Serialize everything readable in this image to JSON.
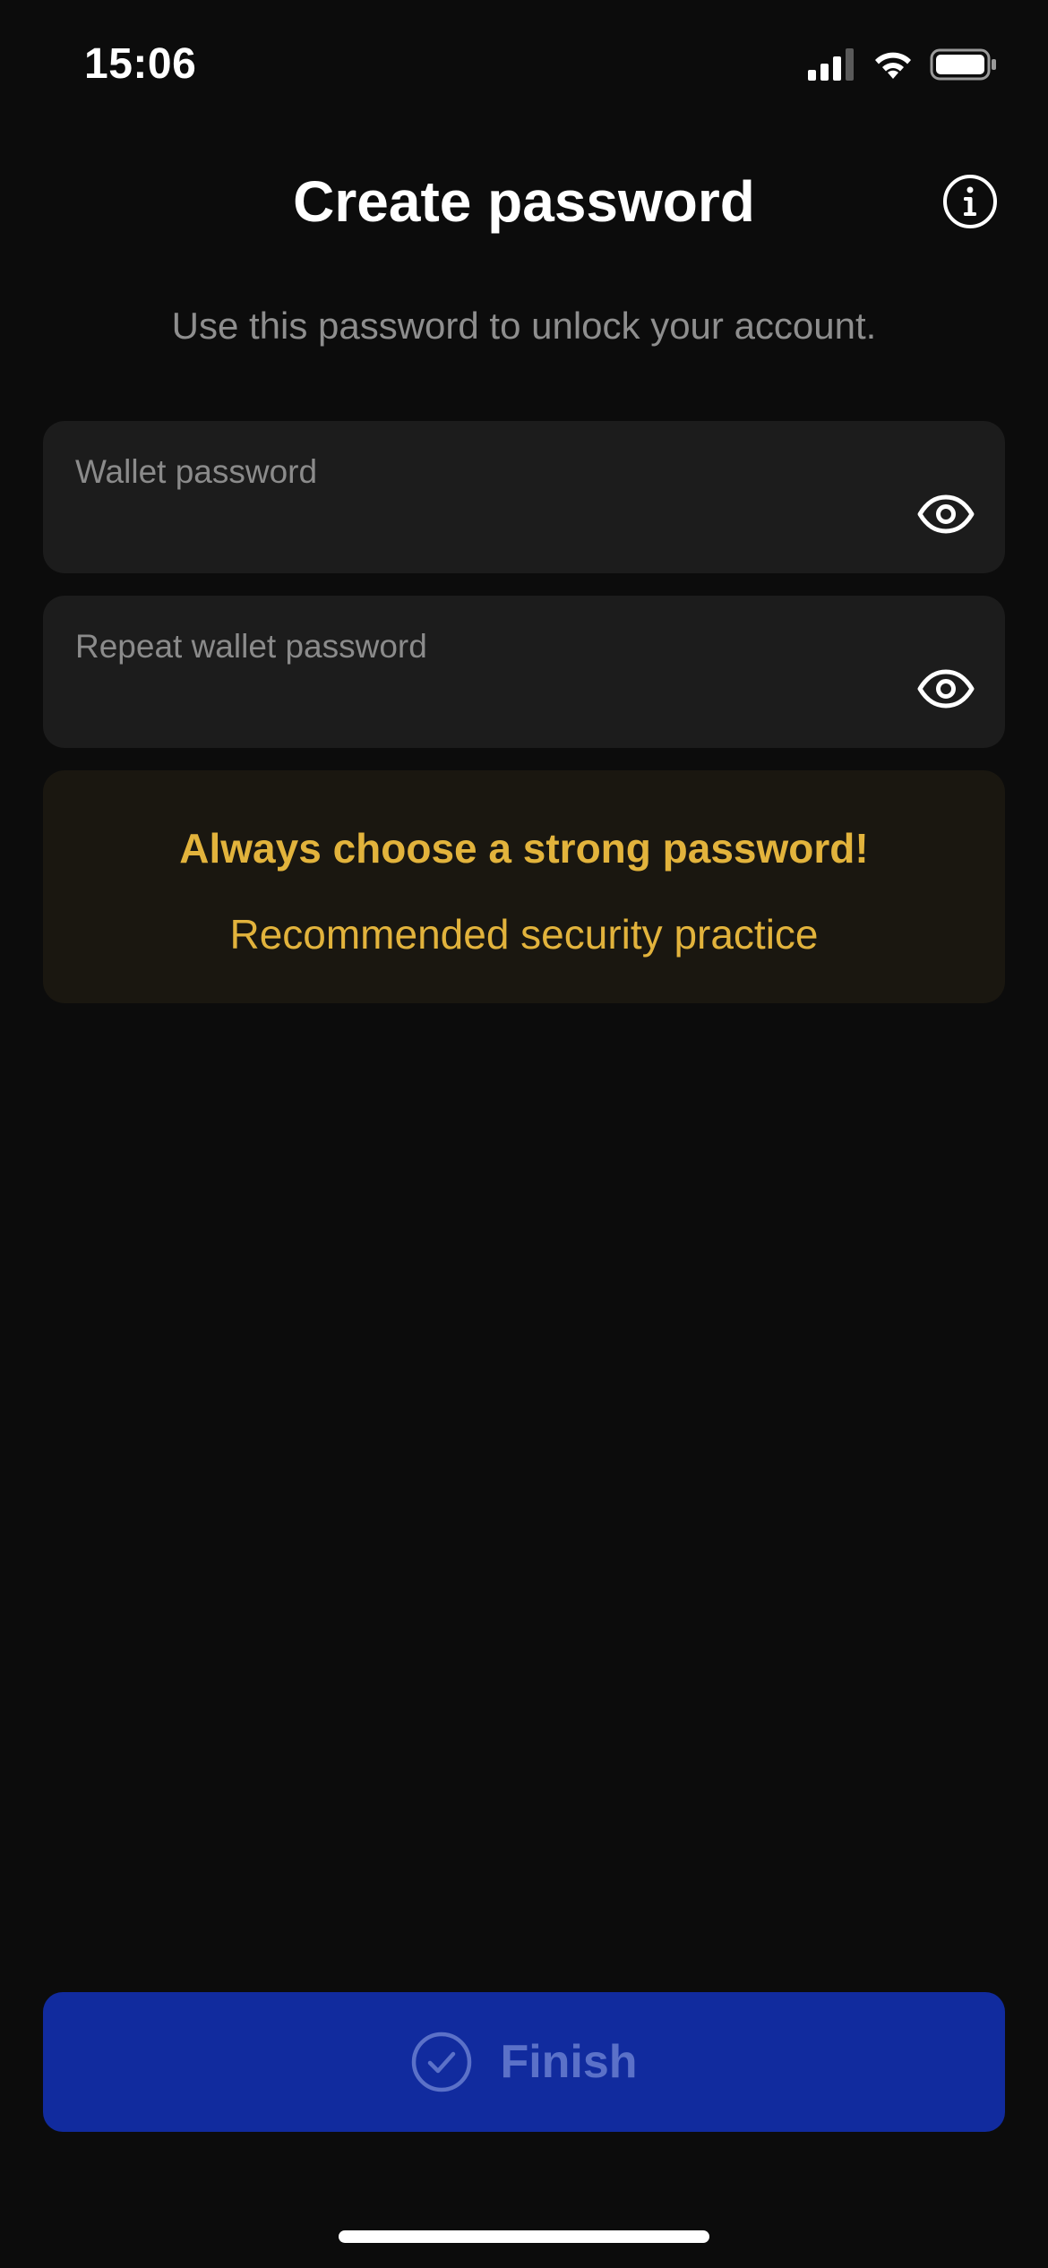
{
  "status_bar": {
    "time": "15:06",
    "icons": [
      "cellular-signal-icon",
      "wifi-icon",
      "battery-icon"
    ]
  },
  "header": {
    "title": "Create password",
    "info_icon": "info-icon"
  },
  "subtitle": "Use this password to unlock your account.",
  "fields": [
    {
      "label": "Wallet password",
      "value": "",
      "icon": "eye-icon"
    },
    {
      "label": "Repeat wallet password",
      "value": "",
      "icon": "eye-icon"
    }
  ],
  "warning": {
    "title": "Always choose a strong password!",
    "subtitle": "Recommended security practice",
    "color": "#e2b33c"
  },
  "finish_button": {
    "label": "Finish",
    "icon": "check-circle-icon",
    "color": "#112b9e",
    "enabled": false
  },
  "colors": {
    "background": "#0c0c0c",
    "field_background": "#1c1c1c",
    "accent": "#112b9e"
  }
}
